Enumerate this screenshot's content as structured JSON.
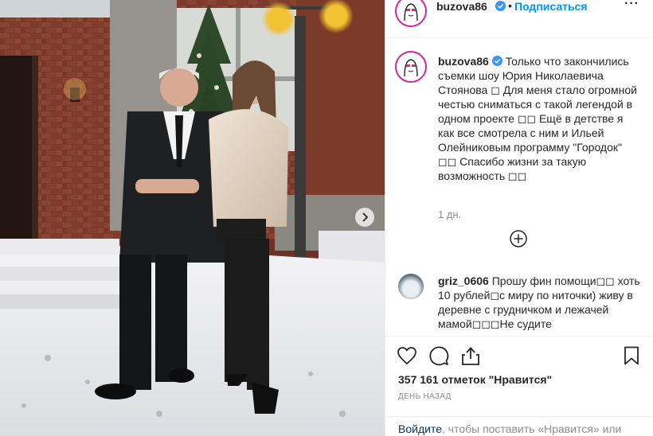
{
  "post": {
    "username": "buzova86",
    "follow_label": "Подписаться",
    "dot": "•",
    "more_label": "···"
  },
  "caption": {
    "username": "buzova86",
    "text": "Только что закончились съемки шоу Юрия Николаевича Стоянова ◻ Для меня стало огромной честью сниматься с такой легендой в одном проекте ◻◻ Ещё в детстве я как все смотрела с ним и Ильей Олейниковым программу \"Городок\" ◻◻ Спасибо жизни за такую возможность ◻◻",
    "time": "1 дн."
  },
  "comment": {
    "username": "griz_0606",
    "text": "Прошу фин помощи◻◻ хоть 10 рублей◻с миру по ниточки) живу в деревне с грудничком и лежачей мамой◻◻◻Не судите"
  },
  "stats": {
    "likes": "357 161 отметок \"Нравится\"",
    "date": "День назад"
  },
  "login": {
    "link": "Войдите",
    "text": ", чтобы поставить «Нравится» или"
  },
  "icons": {
    "like": "heart-icon",
    "comment": "comment-icon",
    "share": "share-icon",
    "save": "bookmark-icon",
    "add_comment": "plus-circle-icon",
    "next": "chevron-right-icon",
    "verified": "verified-badge-icon"
  },
  "colors": {
    "link_blue": "#0095f6",
    "verified_blue": "#3897f0",
    "text": "#262626",
    "muted": "#8e8e8e"
  }
}
